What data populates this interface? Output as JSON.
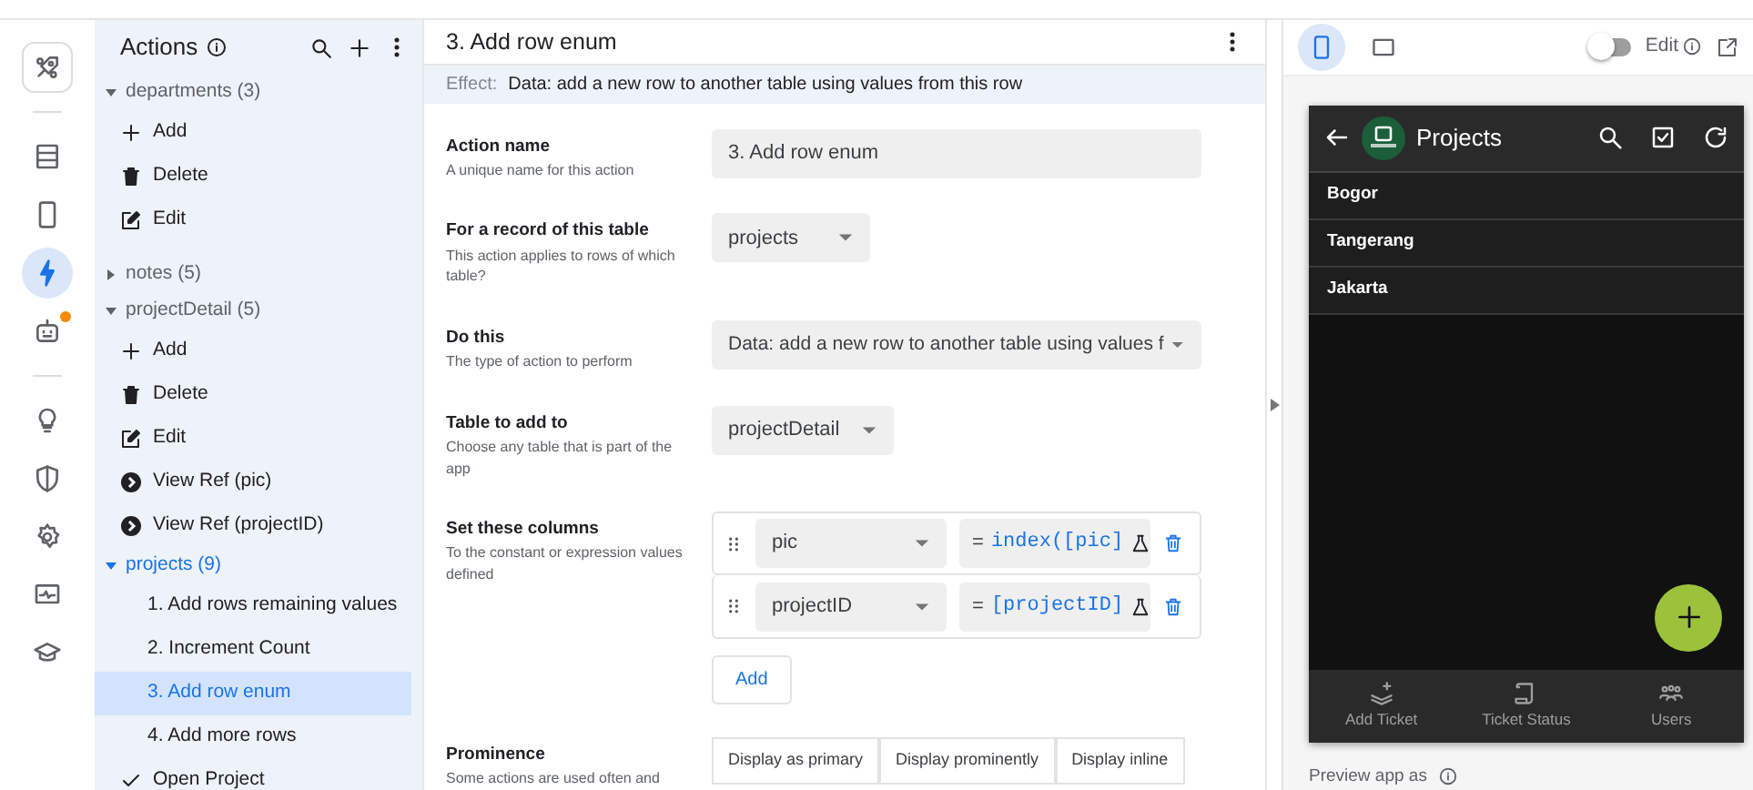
{
  "rail": [
    {
      "selected": false,
      "notification": false
    },
    {
      "selected": false,
      "notification": false
    },
    {
      "selected": false,
      "notification": false
    },
    {
      "selected": true,
      "notification": false
    },
    {
      "selected": false,
      "notification": true
    },
    {
      "selected": false,
      "notification": false
    },
    {
      "selected": false,
      "notification": false
    },
    {
      "selected": false,
      "notification": false
    },
    {
      "selected": false,
      "notification": false
    },
    {
      "selected": false,
      "notification": false
    }
  ],
  "actions_panel": {
    "title": "Actions",
    "groups": [
      {
        "label": "departments (3)",
        "expanded": true,
        "selected": false,
        "items": [
          {
            "kind": "add",
            "label": "Add",
            "selected": false
          },
          {
            "kind": "delete",
            "label": "Delete",
            "selected": false
          },
          {
            "kind": "edit",
            "label": "Edit",
            "selected": false
          }
        ]
      },
      {
        "label": "notes (5)",
        "expanded": false,
        "selected": false
      },
      {
        "label": "projectDetail (5)",
        "expanded": true,
        "selected": false,
        "items": [
          {
            "kind": "add",
            "label": "Add",
            "selected": false
          },
          {
            "kind": "delete",
            "label": "Delete",
            "selected": false
          },
          {
            "kind": "edit",
            "label": "Edit",
            "selected": false
          },
          {
            "kind": "view",
            "label": "View Ref (pic)",
            "selected": false
          },
          {
            "kind": "view",
            "label": "View Ref (projectID)",
            "selected": false
          }
        ]
      },
      {
        "label": "projects (9)",
        "expanded": true,
        "selected": true,
        "items": [
          {
            "kind": "plain",
            "label": "1. Add rows remaining values",
            "selected": false
          },
          {
            "kind": "plain",
            "label": "2. Increment Count",
            "selected": false
          },
          {
            "kind": "plain",
            "label": "3. Add row enum",
            "selected": true
          },
          {
            "kind": "plain",
            "label": "4. Add more rows",
            "selected": false
          },
          {
            "kind": "check",
            "label": "Open Project",
            "selected": false
          }
        ]
      }
    ]
  },
  "editor": {
    "title": "3. Add row enum",
    "effect_label": "Effect:",
    "effect": "Data: add a new row to another table using values from this row",
    "fields": [
      {
        "kind": "text",
        "label": "Action name",
        "hint": "A unique name for this action",
        "value": "3. Add row enum"
      },
      {
        "kind": "select",
        "label": "For a record of this table",
        "hint": "This action applies to rows of which table?",
        "value": "projects"
      },
      {
        "kind": "wide_select",
        "label": "Do this",
        "hint": "The type of action to perform",
        "value": "Data: add a new row to another table using values f"
      },
      {
        "kind": "select",
        "label": "Table to add to",
        "hint": "Choose any table that is part of the app",
        "value": "projectDetail"
      },
      {
        "kind": "columns",
        "label": "Set these columns",
        "hint": "To the constant or expression values defined",
        "rows": [
          {
            "column": "pic",
            "operator": "=",
            "expression": "index([pic]"
          },
          {
            "column": "projectID",
            "operator": "=",
            "expression": "[projectID]"
          }
        ],
        "add_label": "Add"
      },
      {
        "kind": "segmented",
        "label": "Prominence",
        "hint": "Some actions are used often and",
        "options": [
          "Display as primary",
          "Display prominently",
          "Display inline"
        ]
      }
    ]
  },
  "preview": {
    "devices": [
      {
        "kind": "phone",
        "selected": true
      },
      {
        "kind": "tablet",
        "selected": false
      }
    ],
    "edit_on": false,
    "edit_label": "Edit",
    "app": {
      "title": "Projects",
      "rows": [
        "Bogor",
        "Tangerang",
        "Jakarta"
      ],
      "nav": [
        "Add Ticket",
        "Ticket Status",
        "Users"
      ]
    },
    "footer": "Preview app as"
  }
}
